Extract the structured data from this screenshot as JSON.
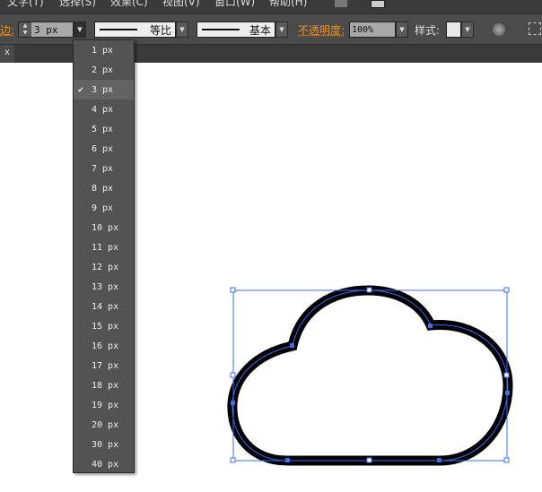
{
  "menu": [
    "文字(T)",
    "选择(S)",
    "效果(C)",
    "视图(V)",
    "窗口(W)",
    "帮助(H)"
  ],
  "control": {
    "stroke_label": "边:",
    "stroke_value": "3 px",
    "profile1": "等比",
    "profile2": "基本",
    "opacity_label": "不透明度:",
    "opacity_value": "100%",
    "style_label": "样式:"
  },
  "tab": {
    "close": "x"
  },
  "dropdown": {
    "items": [
      "1 px",
      "2 px",
      "3 px",
      "4 px",
      "5 px",
      "6 px",
      "7 px",
      "8 px",
      "9 px",
      "10 px",
      "11 px",
      "12 px",
      "13 px",
      "14 px",
      "15 px",
      "16 px",
      "17 px",
      "18 px",
      "19 px",
      "20 px",
      "30 px",
      "40 px"
    ],
    "selected": "3 px"
  },
  "colors": {
    "accent": "#e8932a",
    "selection": "#3d6cf5"
  }
}
